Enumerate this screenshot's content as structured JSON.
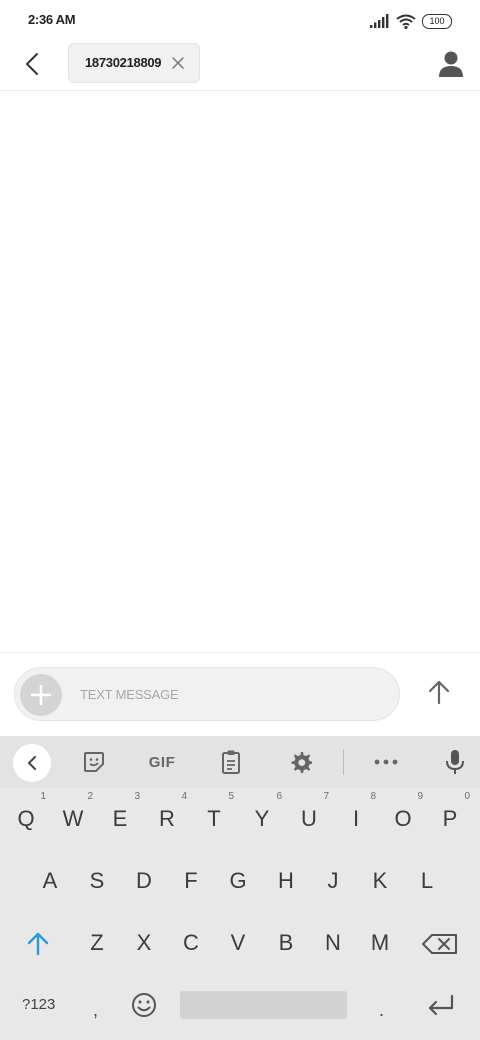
{
  "status_bar": {
    "time": "2:36 AM",
    "battery": "100"
  },
  "header": {
    "recipient": "18730218809"
  },
  "composer": {
    "placeholder": "TEXT MESSAGE"
  },
  "keyboard": {
    "toolbar": {
      "gif_label": "GIF"
    },
    "row1": [
      {
        "label": "Q",
        "hint": "1"
      },
      {
        "label": "W",
        "hint": "2"
      },
      {
        "label": "E",
        "hint": "3"
      },
      {
        "label": "R",
        "hint": "4"
      },
      {
        "label": "T",
        "hint": "5"
      },
      {
        "label": "Y",
        "hint": "6"
      },
      {
        "label": "U",
        "hint": "7"
      },
      {
        "label": "I",
        "hint": "8"
      },
      {
        "label": "O",
        "hint": "9"
      },
      {
        "label": "P",
        "hint": "0"
      }
    ],
    "row2": [
      "A",
      "S",
      "D",
      "F",
      "G",
      "H",
      "J",
      "K",
      "L"
    ],
    "row3": [
      "Z",
      "X",
      "C",
      "V",
      "B",
      "N",
      "M"
    ],
    "row4": {
      "symbols": "?123",
      "comma": ",",
      "period": "."
    }
  },
  "colors": {
    "accent": "#2a9bd8",
    "keyboard_bg": "#e8e8e8",
    "chip_bg": "#f1f1f1"
  }
}
